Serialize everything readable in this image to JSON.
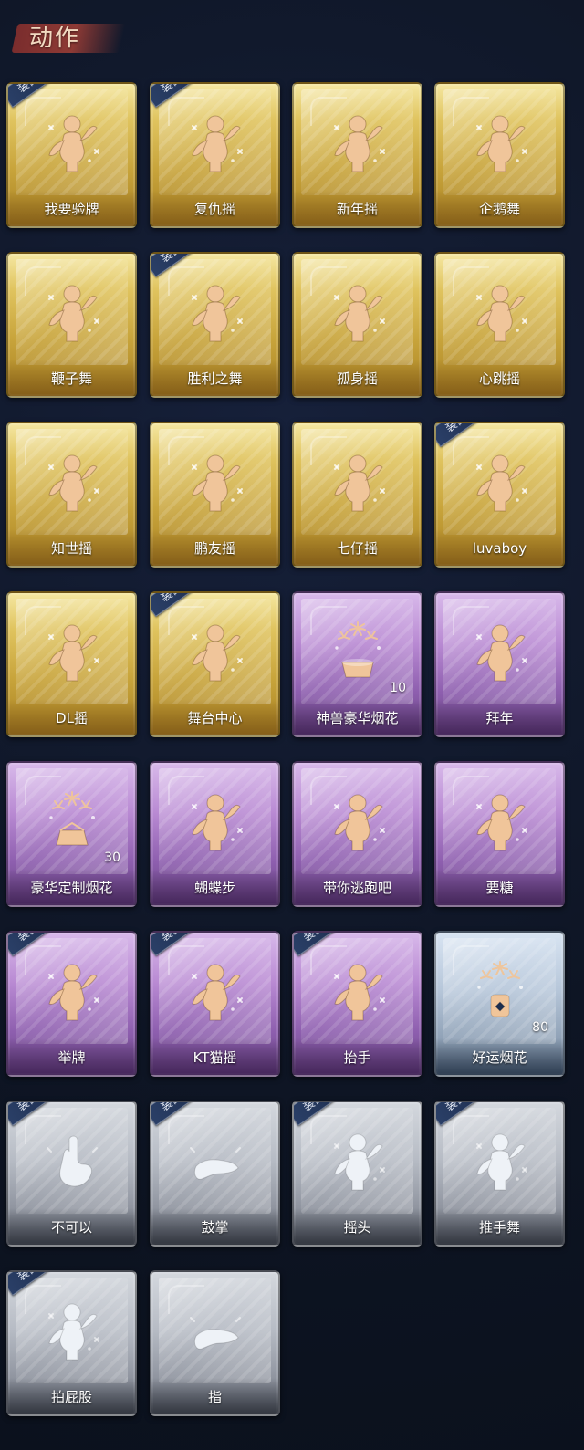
{
  "header": {
    "title": "动作"
  },
  "cards": [
    {
      "label": "我要验牌",
      "variant": "gold",
      "equipped": true,
      "icon": "figure-holding-card-icon"
    },
    {
      "label": "复仇摇",
      "variant": "gold",
      "equipped": true,
      "icon": "figure-pointing-up-icon"
    },
    {
      "label": "新年摇",
      "variant": "gold",
      "equipped": false,
      "icon": "figure-dancing-icon"
    },
    {
      "label": "企鹅舞",
      "variant": "gold",
      "equipped": false,
      "icon": "figure-dancing-icon"
    },
    {
      "label": "鞭子舞",
      "variant": "gold",
      "equipped": false,
      "icon": "figure-dancing-icon"
    },
    {
      "label": "胜利之舞",
      "variant": "gold",
      "equipped": true,
      "icon": "figure-victory-icon"
    },
    {
      "label": "孤身摇",
      "variant": "gold",
      "equipped": false,
      "icon": "figure-dancing-icon"
    },
    {
      "label": "心跳摇",
      "variant": "gold",
      "equipped": false,
      "icon": "figure-hand-up-icon"
    },
    {
      "label": "知世摇",
      "variant": "gold",
      "equipped": false,
      "icon": "figure-dancing-icon"
    },
    {
      "label": "鹏友摇",
      "variant": "gold",
      "equipped": false,
      "icon": "figure-dancing-icon"
    },
    {
      "label": "七仔摇",
      "variant": "gold",
      "equipped": false,
      "icon": "figure-dancing-icon"
    },
    {
      "label": "luvaboy",
      "variant": "gold",
      "equipped": true,
      "icon": "figure-dancing-icon"
    },
    {
      "label": "DL摇",
      "variant": "gold",
      "equipped": false,
      "icon": "figure-arm-raised-icon"
    },
    {
      "label": "舞台中心",
      "variant": "gold",
      "equipped": true,
      "icon": "figure-dancing-icon"
    },
    {
      "label": "神兽豪华烟花",
      "variant": "purple",
      "equipped": false,
      "count": "10",
      "icon": "fireworks-icon"
    },
    {
      "label": "拜年",
      "variant": "purple",
      "equipped": false,
      "icon": "figure-bow-icon"
    },
    {
      "label": "豪华定制烟花",
      "variant": "purple",
      "equipped": false,
      "count": "30",
      "icon": "fireworks-box-icon"
    },
    {
      "label": "蝴蝶步",
      "variant": "purple",
      "equipped": false,
      "icon": "figure-arms-out-icon"
    },
    {
      "label": "带你逃跑吧",
      "variant": "purple",
      "equipped": false,
      "icon": "figure-pointing-icon"
    },
    {
      "label": "要糖",
      "variant": "purple",
      "equipped": false,
      "icon": "figure-reaching-icon"
    },
    {
      "label": "举牌",
      "variant": "purple",
      "equipped": true,
      "icon": "figure-holding-sign-icon"
    },
    {
      "label": "KT猫摇",
      "variant": "purple",
      "equipped": true,
      "icon": "figure-dancing-icon"
    },
    {
      "label": "抬手",
      "variant": "purple",
      "equipped": true,
      "icon": "figure-raising-hand-icon"
    },
    {
      "label": "好运烟花",
      "variant": "blue",
      "equipped": false,
      "count": "80",
      "icon": "firework-can-icon"
    },
    {
      "label": "不可以",
      "variant": "gray",
      "equipped": true,
      "icon": "finger-wag-icon"
    },
    {
      "label": "鼓掌",
      "variant": "gray",
      "equipped": true,
      "icon": "clapping-hands-icon"
    },
    {
      "label": "摇头",
      "variant": "gray",
      "equipped": true,
      "icon": "figure-head-shake-icon"
    },
    {
      "label": "推手舞",
      "variant": "gray",
      "equipped": true,
      "icon": "figure-push-hands-icon"
    },
    {
      "label": "拍屁股",
      "variant": "gray",
      "equipped": true,
      "icon": "figure-slap-icon"
    },
    {
      "label": "指",
      "variant": "gray",
      "equipped": false,
      "icon": "pointing-hand-icon"
    }
  ],
  "badges": {
    "equipped_label": "装配"
  },
  "colors": {
    "background": "#0e1524",
    "header_brush": "#8e3a35",
    "gold": "#d6b44a",
    "purple": "#b98ad3",
    "blue": "#b7c7da",
    "gray": "#b7bcc5",
    "badge": "#2a3f67"
  }
}
